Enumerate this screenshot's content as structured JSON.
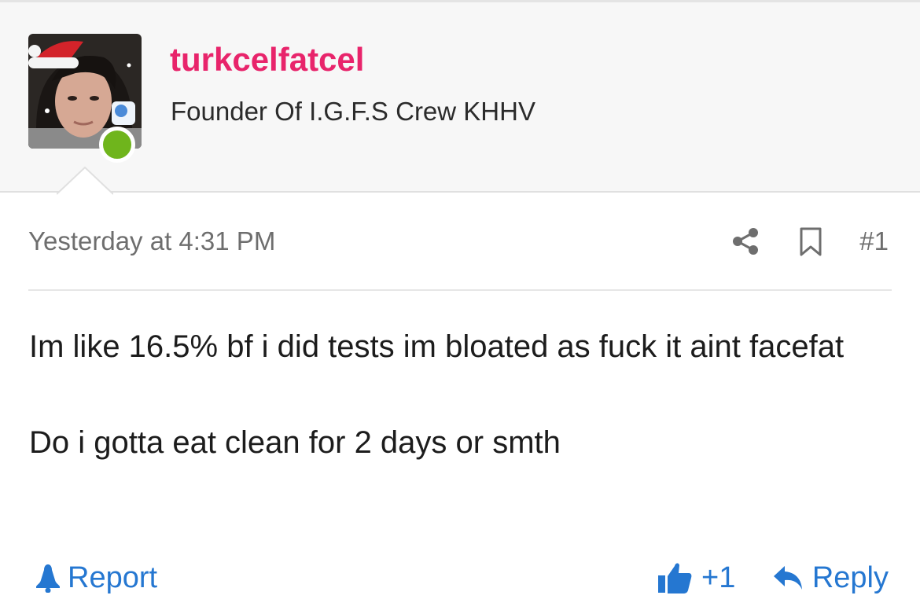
{
  "user": {
    "username": "turkcelfatcel",
    "title": "Founder Of I.G.F.S Crew KHHV",
    "avatar_icon": "user-avatar-photo",
    "online_status": "online",
    "online_color": "#6fb51c",
    "username_color": "#e8246b"
  },
  "post": {
    "date": "Yesterday at 4:31 PM",
    "number": "#1",
    "share_icon": "share-icon",
    "bookmark_icon": "bookmark-icon",
    "body_paragraphs": [
      "Im like 16.5% bf i did tests im bloated as fuck it aint facefat",
      "Do i gotta eat clean for 2 days or smth"
    ]
  },
  "actions": {
    "report_label": "Report",
    "report_icon": "warning-triangle-icon",
    "like_count": "+1",
    "like_icon": "thumbs-up-icon",
    "reply_label": "Reply",
    "reply_icon": "reply-arrow-icon",
    "link_color": "#2577d1"
  }
}
